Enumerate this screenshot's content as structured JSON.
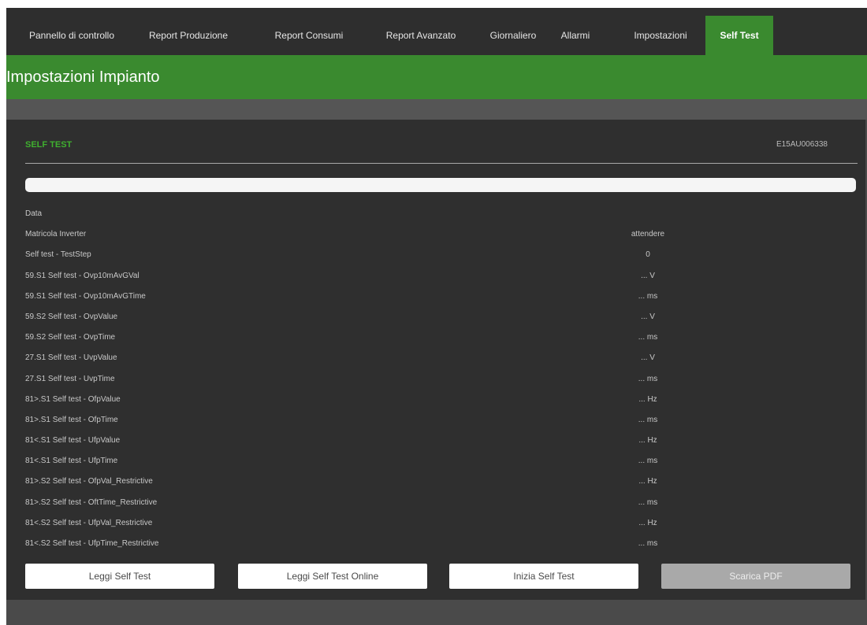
{
  "nav": {
    "tabs": [
      {
        "label": "Pannello di controllo",
        "active": false
      },
      {
        "label": "Report Produzione",
        "active": false
      },
      {
        "label": "Report Consumi",
        "active": false
      },
      {
        "label": "Report Avanzato",
        "active": false
      },
      {
        "label": "Giornaliero",
        "active": false
      },
      {
        "label": "Allarmi",
        "active": false
      },
      {
        "label": "Impostazioni",
        "active": false
      },
      {
        "label": "Self Test",
        "active": true
      }
    ]
  },
  "page": {
    "title": "Impostazioni Impianto"
  },
  "panel": {
    "title": "SELF TEST",
    "serial": "E15AU006338",
    "progress": 0
  },
  "rows": [
    {
      "label": "Data",
      "value": ""
    },
    {
      "label": "Matricola Inverter",
      "value": "attendere"
    },
    {
      "label": "Self test - TestStep",
      "value": "0"
    },
    {
      "label": "59.S1 Self test - Ovp10mAvGVal",
      "value": "... V"
    },
    {
      "label": "59.S1 Self test - Ovp10mAvGTime",
      "value": "... ms"
    },
    {
      "label": "59.S2 Self test - OvpValue",
      "value": "... V"
    },
    {
      "label": "59.S2 Self test - OvpTime",
      "value": "... ms"
    },
    {
      "label": "27.S1 Self test - UvpValue",
      "value": "... V"
    },
    {
      "label": "27.S1 Self test - UvpTime",
      "value": "... ms"
    },
    {
      "label": "81>.S1 Self test - OfpValue",
      "value": "... Hz"
    },
    {
      "label": "81>.S1 Self test - OfpTime",
      "value": "... ms"
    },
    {
      "label": "81<.S1 Self test - UfpValue",
      "value": "... Hz"
    },
    {
      "label": "81<.S1 Self test - UfpTime",
      "value": "... ms"
    },
    {
      "label": "81>.S2 Self test - OfpVal_Restrictive",
      "value": "... Hz"
    },
    {
      "label": "81>.S2 Self test - OftTime_Restrictive",
      "value": "... ms"
    },
    {
      "label": "81<.S2 Self test - UfpVal_Restrictive",
      "value": "... Hz"
    },
    {
      "label": "81<.S2 Self test - UfpTime_Restrictive",
      "value": "... ms"
    }
  ],
  "buttons": {
    "read": "Leggi Self Test",
    "read_online": "Leggi Self Test Online",
    "start": "Inizia Self Test",
    "download_pdf": "Scarica PDF"
  },
  "colors": {
    "accent_green": "#3a8a2f",
    "title_green": "#3fb02f",
    "nav_bg": "#2e2e2e",
    "panel_bg": "#2f2f2f",
    "page_bg": "#4a4a4a"
  }
}
